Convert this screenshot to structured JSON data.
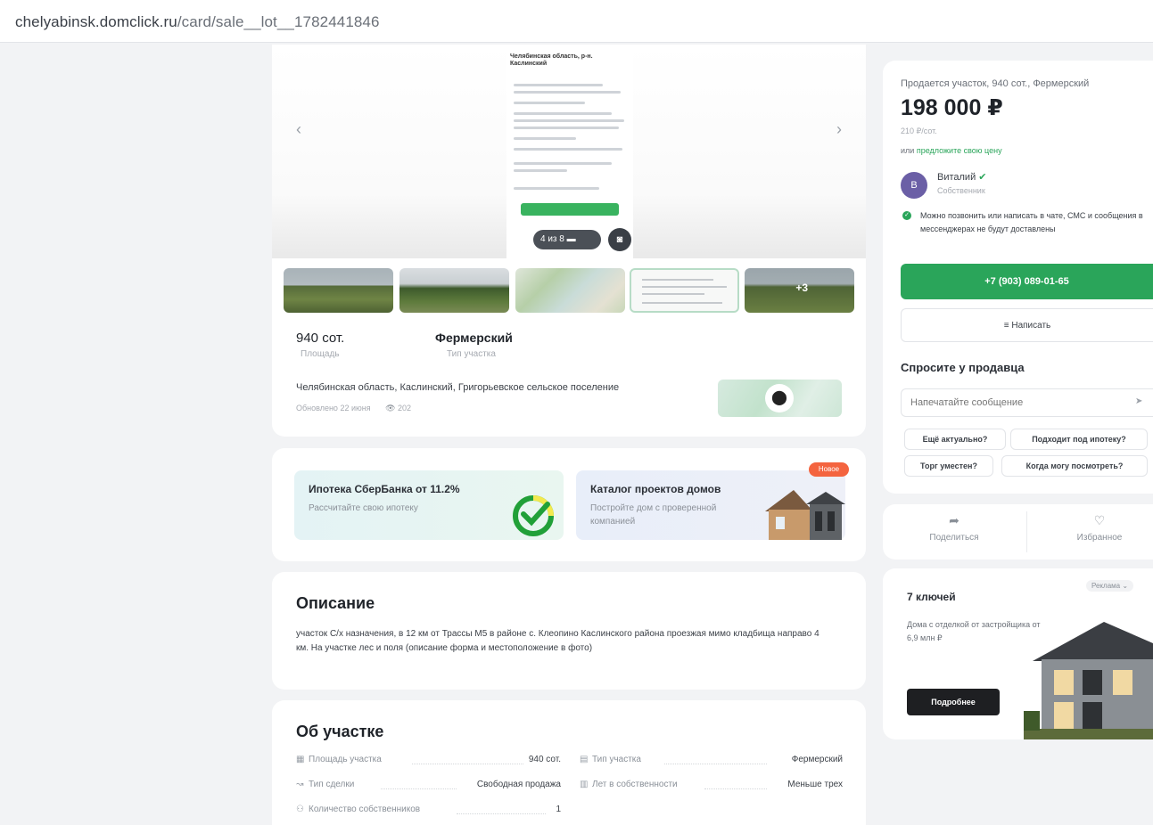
{
  "browser": {
    "url_host": "chelyabinsk.domclick.ru",
    "url_path": "/card/sale__lot__1782441846"
  },
  "gallery": {
    "prev_icon": "chevron-left-icon",
    "next_icon": "chevron-right-icon",
    "screenshot_header": "Челябинская область, р-н. Каслинский",
    "counter": "4 из 8",
    "more_count": "+3"
  },
  "summary": {
    "area_value": "940 сот.",
    "area_label": "Площадь",
    "type_value": "Фермерский",
    "type_label": "Тип участка",
    "address": "Челябинская область, Каслинский, Григорьевское сельское поселение",
    "updated": "Обновлено 22 июня",
    "views": "202"
  },
  "promos": {
    "mortgage_title": "Ипотека СберБанка от 11.2%",
    "mortgage_sub": "Рассчитайте свою ипотеку",
    "catalog_title": "Каталог проектов домов",
    "catalog_sub": "Постройте дом с проверенной компанией",
    "new_badge": "Новое"
  },
  "description": {
    "heading": "Описание",
    "text": "участок С/х назначения, в 12 км от Трассы М5 в районе с. Клеопино Каслинского района проезжая мимо кладбища направо 4 км. На участке лес и поля (описание форма и местоположение в фото)"
  },
  "about": {
    "heading": "Об участке",
    "rows": [
      {
        "label": "Площадь участка",
        "value": "940 сот."
      },
      {
        "label": "Тип участка",
        "value": "Фермерский"
      },
      {
        "label": "Тип сделки",
        "value": "Свободная продажа"
      },
      {
        "label": "Лет в собственности",
        "value": "Меньше трех"
      },
      {
        "label": "Количество собственников",
        "value": "1"
      }
    ]
  },
  "sidebar": {
    "title": "Продается участок, 940 сот., Фермерский",
    "price": "198 000 ₽",
    "price_per_unit": "210 ₽/сот.",
    "offer_prefix": "или",
    "offer_link": "предложите свою цену",
    "seller_initial": "В",
    "seller_name": "Виталий",
    "seller_role": "Собственник",
    "note": "Можно позвонить или написать в чате, СМС и сообщения в мессенджерах не будут доставлены",
    "phone": "+7 (903) 089-01-65",
    "write": "Написать",
    "ask_title": "Спросите у продавца",
    "message_placeholder": "Напечатайте сообщение",
    "chips": [
      "Ещё актуально?",
      "Подходит под ипотеку?",
      "Торг уместен?",
      "Когда могу посмотреть?"
    ]
  },
  "actions": {
    "share": "Поделиться",
    "favorite": "Избранное"
  },
  "ad": {
    "badge": "Реклама",
    "title": "7 ключей",
    "subtitle": "Дома с отделкой от застройщика от 6,9 млн ₽",
    "button": "Подробнее"
  },
  "colors": {
    "accent_green": "#2aa55a",
    "badge_orange": "#f4643f",
    "avatar_purple": "#6b5fa6"
  }
}
